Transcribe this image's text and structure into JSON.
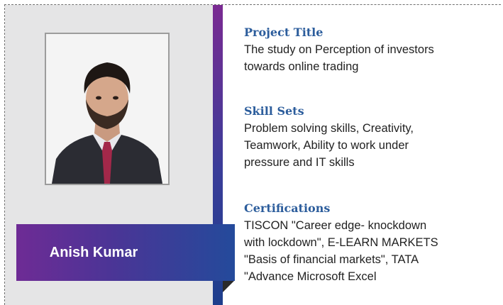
{
  "profile": {
    "name": "Anish Kumar"
  },
  "project": {
    "heading": "Project Title",
    "lines": [
      "The study on Perception of investors",
      "towards online trading"
    ]
  },
  "skills": {
    "heading": "Skill Sets",
    "lines": [
      "Problem solving skills, Creativity,",
      "Teamwork, Ability to work under",
      "pressure and IT skills"
    ]
  },
  "certifications": {
    "heading": "Certifications",
    "lines": [
      "TISCON \"Career edge- knockdown",
      "with lockdown\", E-LEARN MARKETS",
      "\"Basis of financial markets\", TATA",
      "\"Advance Microsoft Excel"
    ]
  },
  "colors": {
    "heading": "#2c5d9c",
    "ribbon_start": "#6e2b95",
    "ribbon_end": "#244a9b",
    "panel": "#e5e5e6"
  }
}
